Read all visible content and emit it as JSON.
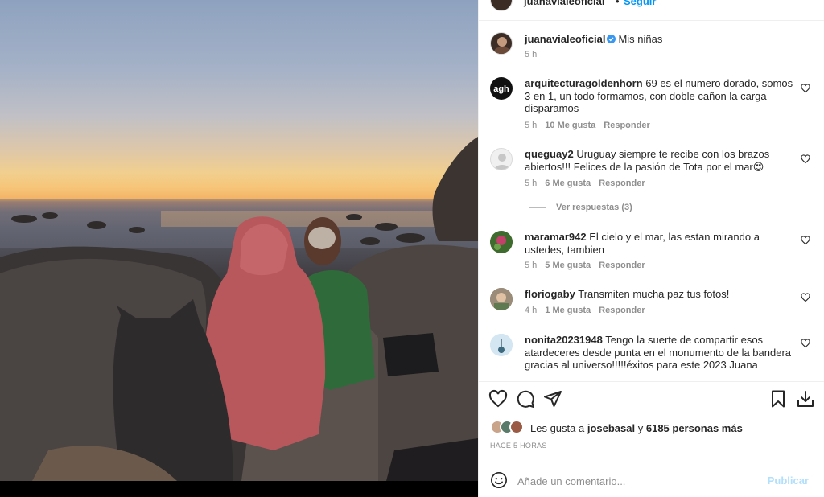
{
  "post": {
    "author": "juanavialeoficial",
    "follow_label": "Seguir",
    "separator": "•",
    "more": "···",
    "caption": "Mis niñas",
    "caption_time": "5 h"
  },
  "comments": [
    {
      "user": "arquitecturagoldenhorn",
      "text": "69 es el numero dorado, somos 3 en 1, un todo formamos, con doble cañon la carga disparamos",
      "time": "5 h",
      "likes": "10 Me gusta",
      "reply": "Responder",
      "avatar_text": "agh"
    },
    {
      "user": "queguay2",
      "text": "Uruguay siempre te recibe con los brazos abiertos!!! Felices de la pasión de Tota por el mar😍",
      "time": "5 h",
      "likes": "6 Me gusta",
      "reply": "Responder"
    },
    {
      "user": "maramar942",
      "text": "El cielo y el mar, las estan mirando a ustedes, tambien",
      "time": "5 h",
      "likes": "5 Me gusta",
      "reply": "Responder"
    },
    {
      "user": "floriogaby",
      "text": "Transmiten mucha paz tus fotos!",
      "time": "4 h",
      "likes": "1 Me gusta",
      "reply": "Responder"
    },
    {
      "user": "nonita20231948",
      "text": "Tengo la suerte de compartir esos atardeceres desde punta en el monumento de la bandera gracias al universo!!!!!éxitos para este 2023 Juana"
    }
  ],
  "view_replies": "Ver respuestas (3)",
  "likes": {
    "prefix": "Les gusta a",
    "user": "josebasal",
    "and": "y",
    "others": "6185 personas más"
  },
  "timestamp": "HACE 5 HORAS",
  "comment_input": {
    "placeholder": "Añade un comentario...",
    "post_label": "Publicar"
  },
  "colors": {
    "accent": "#0095f6",
    "post_disabled": "#b2dffc",
    "muted": "#8e8e8e"
  },
  "icons": [
    "heart-icon",
    "comment-icon",
    "share-icon",
    "bookmark-icon",
    "download-icon",
    "emoji-icon",
    "verified-badge-icon"
  ]
}
